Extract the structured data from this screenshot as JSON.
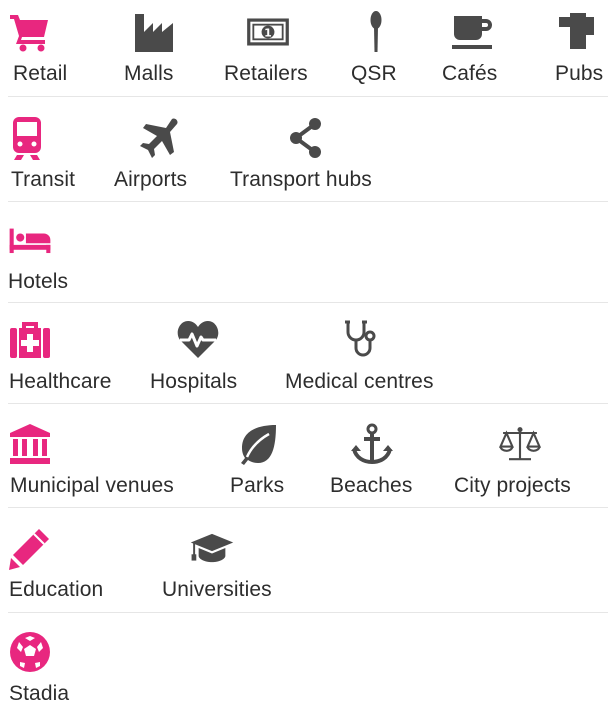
{
  "colors": {
    "accent": "#e8277f",
    "icon_gray": "#4a4a4a",
    "divider": "#e6e6e6"
  },
  "groups": [
    {
      "items": [
        {
          "label": "Retail",
          "icon": "shopping-cart-icon"
        },
        {
          "label": "Malls",
          "icon": "factory-icon"
        },
        {
          "label": "Retailers",
          "icon": "banknote-icon"
        },
        {
          "label": "QSR",
          "icon": "spoon-icon"
        },
        {
          "label": "Cafés",
          "icon": "coffee-cup-icon"
        },
        {
          "label": "Pubs",
          "icon": "beer-mug-icon"
        }
      ]
    },
    {
      "items": [
        {
          "label": "Transit",
          "icon": "train-icon"
        },
        {
          "label": "Airports",
          "icon": "airplane-icon"
        },
        {
          "label": "Transport hubs",
          "icon": "share-nodes-icon"
        }
      ]
    },
    {
      "items": [
        {
          "label": "Hotels",
          "icon": "bed-icon"
        }
      ]
    },
    {
      "items": [
        {
          "label": "Healthcare",
          "icon": "medkit-icon"
        },
        {
          "label": "Hospitals",
          "icon": "heartbeat-icon"
        },
        {
          "label": "Medical centres",
          "icon": "stethoscope-icon"
        }
      ]
    },
    {
      "items": [
        {
          "label": "Municipal venues",
          "icon": "institution-icon"
        },
        {
          "label": "Parks",
          "icon": "leaf-icon"
        },
        {
          "label": "Beaches",
          "icon": "anchor-icon"
        },
        {
          "label": "City projects",
          "icon": "balance-scale-icon"
        }
      ]
    },
    {
      "items": [
        {
          "label": "Education",
          "icon": "pencil-icon"
        },
        {
          "label": "Universities",
          "icon": "graduation-cap-icon"
        }
      ]
    },
    {
      "items": [
        {
          "label": "Stadia",
          "icon": "soccer-ball-icon"
        }
      ]
    }
  ]
}
